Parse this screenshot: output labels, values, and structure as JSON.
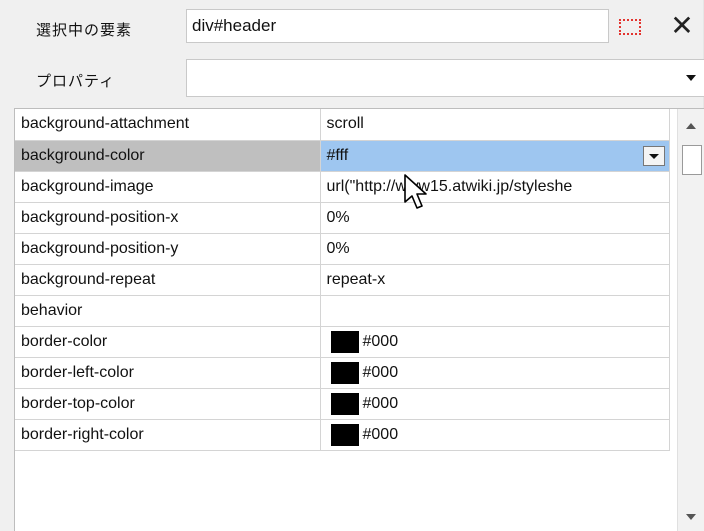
{
  "header": {
    "selected_element_label": "選択中の要素",
    "selected_element_value": "div#header",
    "property_label": "プロパティ",
    "property_value": "",
    "pick_icon": "dotted-select-icon",
    "close_icon": "close-icon",
    "close_glyph": "✕"
  },
  "properties": [
    {
      "name": "background-attachment",
      "value": "scroll"
    },
    {
      "name": "background-color",
      "value": "#fff",
      "selected": true
    },
    {
      "name": "background-image",
      "value": "url(\"http://www15.atwiki.jp/styleshe"
    },
    {
      "name": "background-position-x",
      "value": "0%"
    },
    {
      "name": "background-position-y",
      "value": "0%"
    },
    {
      "name": "background-repeat",
      "value": "repeat-x"
    },
    {
      "name": "behavior",
      "value": ""
    },
    {
      "name": "border-color",
      "value": "#000",
      "swatch": "#000000"
    },
    {
      "name": "border-left-color",
      "value": "#000",
      "swatch": "#000000"
    },
    {
      "name": "border-top-color",
      "value": "#000",
      "swatch": "#000000"
    },
    {
      "name": "border-right-color",
      "value": "#000",
      "swatch": "#000000"
    }
  ],
  "colors": {
    "selected_name_bg": "#bfbfbf",
    "selected_value_bg": "#9ec6f0",
    "pick_icon_border": "#e3342f"
  }
}
